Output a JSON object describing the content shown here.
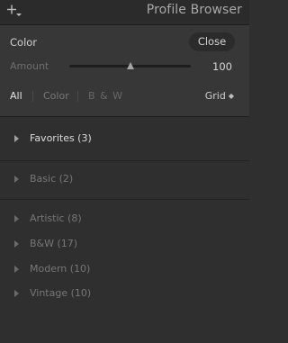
{
  "header": {
    "title": "Profile Browser",
    "add_icon": "add-profile-icon"
  },
  "controls": {
    "selected_profile": "Color",
    "close_label": "Close",
    "amount_label": "Amount",
    "amount_value": "100",
    "amount_level_fraction": 0.5
  },
  "filters": {
    "all": "All",
    "color": "Color",
    "bw": "B & W",
    "view": "Grid"
  },
  "groups": [
    {
      "label": "Favorites (3)"
    },
    {
      "label": "Basic (2)"
    },
    {
      "label": "Artistic (8)"
    },
    {
      "label": "B&W (17)"
    },
    {
      "label": "Modern (10)"
    },
    {
      "label": "Vintage (10)"
    }
  ]
}
